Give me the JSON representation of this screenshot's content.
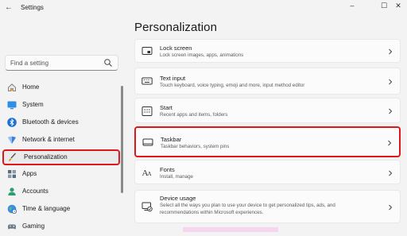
{
  "window": {
    "title": "Settings",
    "controls": {
      "minimize": "–",
      "maximize": "☐",
      "close": "✕"
    }
  },
  "search": {
    "placeholder": "Find a setting",
    "value": ""
  },
  "nav": {
    "items": [
      {
        "label": "Home",
        "icon": "home-icon"
      },
      {
        "label": "System",
        "icon": "monitor-icon"
      },
      {
        "label": "Bluetooth & devices",
        "icon": "bluetooth-icon"
      },
      {
        "label": "Network & internet",
        "icon": "network-icon"
      },
      {
        "label": "Personalization",
        "icon": "brush-icon",
        "selected": true
      },
      {
        "label": "Apps",
        "icon": "apps-icon"
      },
      {
        "label": "Accounts",
        "icon": "accounts-icon"
      },
      {
        "label": "Time & language",
        "icon": "globe-icon"
      },
      {
        "label": "Gaming",
        "icon": "gamepad-icon"
      }
    ]
  },
  "page": {
    "title": "Personalization"
  },
  "cards": [
    {
      "title": "Lock screen",
      "description": "Lock screen images, apps, animations",
      "icon": "lock-screen-icon"
    },
    {
      "title": "Text input",
      "description": "Touch keyboard, voice typing, emoji and more, input method editor",
      "icon": "keyboard-icon"
    },
    {
      "title": "Start",
      "description": "Recent apps and items, folders",
      "icon": "start-icon"
    },
    {
      "title": "Taskbar",
      "description": "Taskbar behaviors, system pins",
      "icon": "taskbar-icon",
      "highlighted": true
    },
    {
      "title": "Fonts",
      "description": "Install, manage",
      "icon": "fonts-icon"
    },
    {
      "title": "Device usage",
      "description": "Select all the ways you plan to use your device to get personalized tips, ads, and recommendations within Microsoft experiences.",
      "icon": "device-usage-icon"
    }
  ],
  "colors": {
    "accent": "#0067c0",
    "highlight_border": "#e0161d",
    "background": "#f3f3f3",
    "card": "#fbfbfb"
  }
}
